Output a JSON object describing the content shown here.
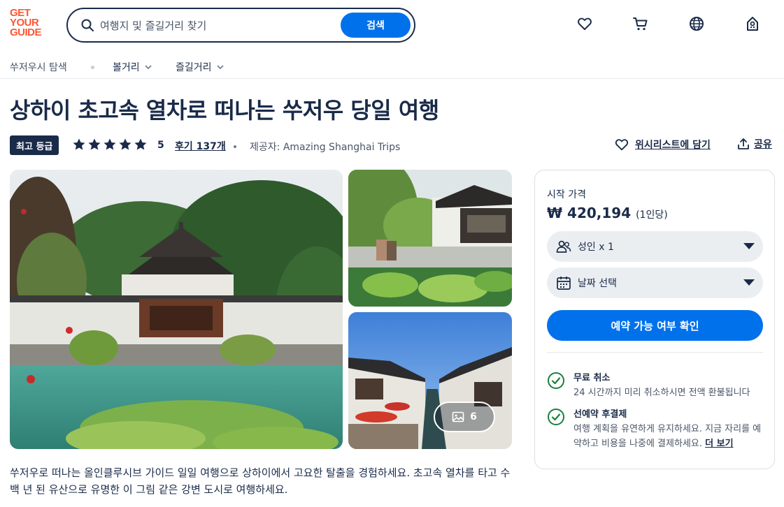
{
  "header": {
    "logo_lines": [
      "GET",
      "YOUR",
      "GUIDE"
    ],
    "search_placeholder": "여행지 및 즐길거리 찾기",
    "search_button": "검색",
    "icons": [
      "heart-icon",
      "cart-icon",
      "globe-icon",
      "account-icon"
    ]
  },
  "subnav": {
    "explore": "쑤저우시 탐색",
    "sights": "볼거리",
    "activities": "즐길거리"
  },
  "activity": {
    "title": "상하이 초고속 열차로 떠나는 쑤저우 당일 여행",
    "badge": "최고 등급",
    "rating": "5",
    "stars": 5,
    "reviews": "후기 137개",
    "provider_label": "제공자:",
    "provider_name": "Amazing Shanghai Trips",
    "wishlist": "위시리스트에 담기",
    "share": "공유",
    "gallery_count": "6",
    "description": "쑤저우로 떠나는 올인클루시브 가이드 일일 여행으로 상하이에서 고요한 탈출을 경험하세요. 초고속 열차를 타고 수백 년 된 유산으로 유명한 이 그림 같은 강변 도시로 여행하세요."
  },
  "booking": {
    "from_label": "시작 가격",
    "price": "₩ 420,194",
    "per_person": "(1인당)",
    "participants": "성인 x 1",
    "date_select": "날짜 선택",
    "check_availability": "예약 가능 여부 확인",
    "features": [
      {
        "title": "무료 취소",
        "desc": "24 시간까지 미리 취소하시면 전액 환불됩니다"
      },
      {
        "title": "선예약 후결제",
        "desc": "여행 계획을 유연하게 유지하세요. 지금 자리를 예약하고 비용을 나중에 결제하세요.",
        "link": "더 보기"
      }
    ]
  },
  "colors": {
    "brand": "#ff5533",
    "primary": "#0071eb",
    "navy": "#1a2b49",
    "check": "#1a7f3c"
  }
}
